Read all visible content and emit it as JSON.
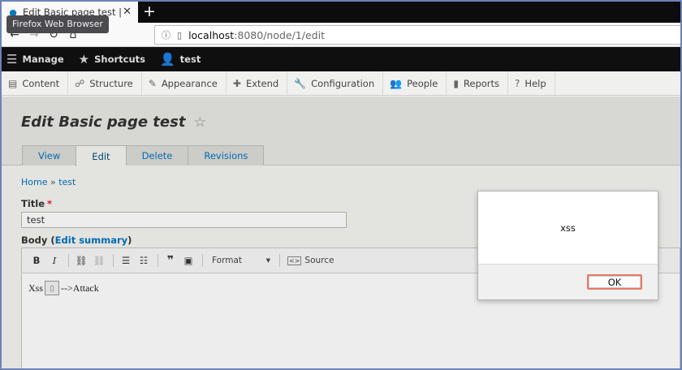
{
  "browser": {
    "tab_title": "Edit Basic page test | test",
    "tooltip": "Firefox Web Browser",
    "new_tab": "+",
    "url_host": "localhost",
    "url_rest": ":8080/node/1/edit"
  },
  "admin_bar": {
    "manage": "Manage",
    "shortcuts": "Shortcuts",
    "user": "test"
  },
  "tray": {
    "items": [
      "Content",
      "Structure",
      "Appearance",
      "Extend",
      "Configuration",
      "People",
      "Reports",
      "Help"
    ]
  },
  "page": {
    "title": "Edit Basic page test",
    "tabs": [
      "View",
      "Edit",
      "Delete",
      "Revisions"
    ],
    "active_tab": "Edit"
  },
  "breadcrumb": {
    "home": "Home",
    "separator": "»",
    "current": "test"
  },
  "form": {
    "title_label": "Title",
    "required_mark": "*",
    "title_value": "test",
    "body_label": "Body",
    "edit_summary": "Edit summary",
    "format_label": "Format",
    "source_label": "Source",
    "body_text_before": "Xss",
    "body_text_after": "-->Attack"
  },
  "dialog": {
    "message": "xss",
    "ok_label": "OK"
  },
  "colors": {
    "link": "#0074bd",
    "admin_bar": "#0f0f0f",
    "required": "#e31f1f",
    "ok_focus": "#e57a64"
  }
}
